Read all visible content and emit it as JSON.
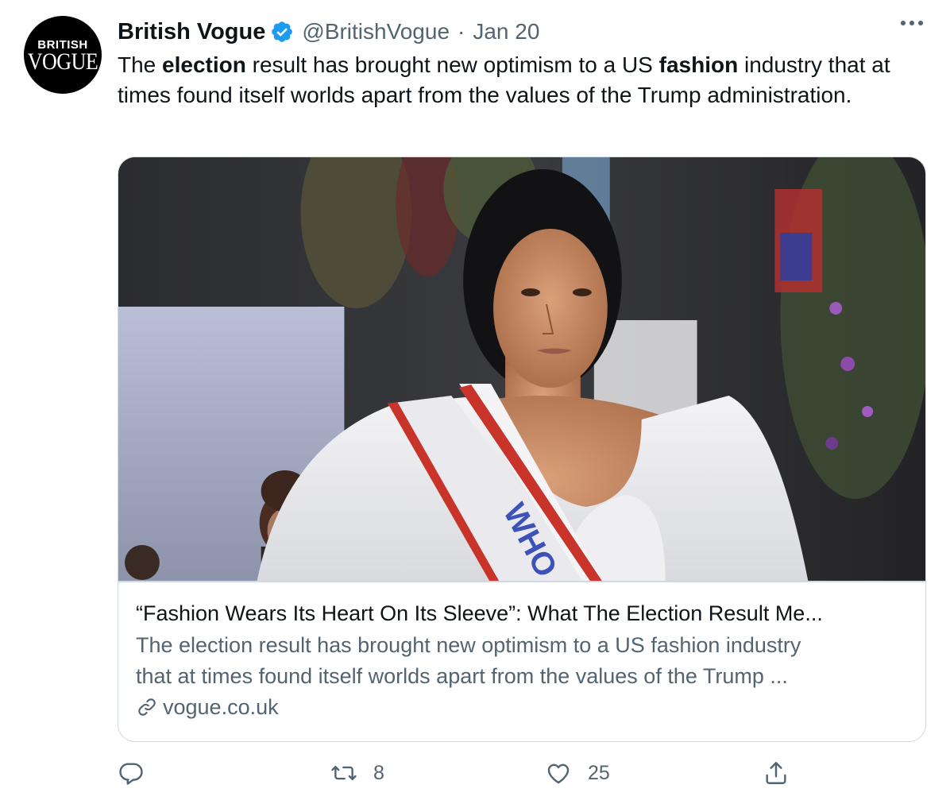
{
  "tweet": {
    "author_name": "British Vogue",
    "handle": "@BritishVogue",
    "separator": "·",
    "date": "Jan 20",
    "avatar": {
      "line1": "BRITISH",
      "line2": "VOGUE"
    },
    "text_parts": [
      "The ",
      "election",
      " result has brought new optimism to a US ",
      "fashion",
      " industry that at times found itself worlds apart from the values of the Trump administration."
    ],
    "icons": {
      "verified": "verified-badge-icon",
      "more": "more-options-icon"
    }
  },
  "card": {
    "title": "“Fashion Wears Its Heart On Its Sleeve”: What The Election Result Me...",
    "description_lines": [
      "The election result has brought new optimism to a US fashion industry",
      "that at times found itself worlds apart from the values of the Trump ..."
    ],
    "domain": "vogue.co.uk",
    "image_sash_text": "WHO"
  },
  "actions": {
    "reply_count": "",
    "retweet_count": "8",
    "like_count": "25"
  },
  "colors": {
    "verified_blue": "#1d9bf0",
    "secondary_text": "#536471",
    "border": "#cfd9de"
  }
}
